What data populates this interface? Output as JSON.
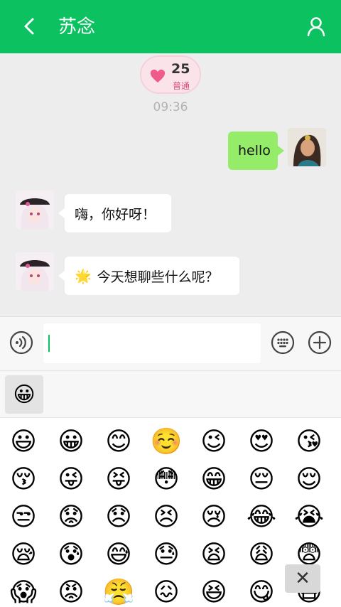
{
  "header": {
    "title": "苏念",
    "back_icon": "chevron-left-icon",
    "profile_icon": "person-icon",
    "bg": "#0bc160"
  },
  "intimacy": {
    "value": "25",
    "level": "普通"
  },
  "time": "09:36",
  "messages": [
    {
      "from": "me",
      "text": "hello"
    },
    {
      "from": "other",
      "text": "嗨，你好呀！"
    },
    {
      "from": "other",
      "emoji": "🌟",
      "text": "今天想聊些什么呢？"
    }
  ],
  "input": {
    "value": "",
    "placeholder": ""
  },
  "emoji_tab": "😀",
  "emojis": [
    "😃",
    "😀",
    "😊",
    "☺️",
    "😉",
    "😍",
    "😘",
    "😚",
    "😜",
    "😝",
    "😳",
    "😁",
    "😔",
    "😌",
    "😒",
    "😟",
    "😞",
    "😣",
    "😢",
    "😂",
    "😭",
    "😪",
    "😰",
    "😅",
    "😓",
    "😫",
    "😩",
    "😨",
    "😱",
    "😡",
    "😤",
    "😖",
    "😆",
    "😋",
    "😷"
  ]
}
